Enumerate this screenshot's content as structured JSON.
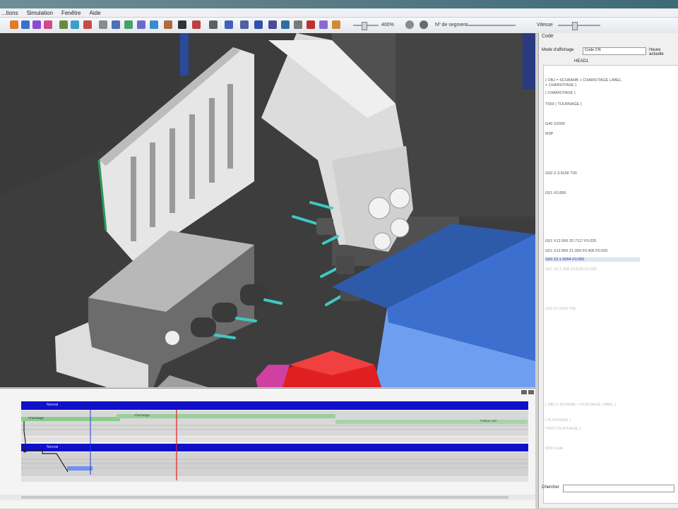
{
  "menu": {
    "items": [
      "...tions",
      "Simulation",
      "Fenêtre",
      "Aide"
    ]
  },
  "toolbar": {
    "zoom": "400%",
    "segment_label": "Nº de segment",
    "speed_label": "Vitesse"
  },
  "panel": {
    "title": "Code",
    "mode_label": "Mode d'affichage",
    "mode_value": "Code CN",
    "position_label": "Heure actuelle",
    "header": "HEAD1",
    "code_lines": [
      {
        "text": "( OBJ = SCHAAHB + CHARIOTAGE LABEL",
        "cls": ""
      },
      {
        "text": "+ CHARIOTAGE )",
        "cls": ""
      },
      {
        "text": "( CHARIOTAGE )",
        "cls": ""
      },
      {
        "text": "T500 ( TOURNAGE )",
        "cls": ""
      },
      {
        "text": "G40 S2000",
        "cls": ""
      },
      {
        "text": "M3P",
        "cls": ""
      },
      {
        "text": "G00 Z-3.8106 T00",
        "cls": ""
      },
      {
        "text": "G01 X0.856",
        "cls": ""
      },
      {
        "text": "G01 X12.066 Z0.7117 F0.025",
        "cls": ""
      },
      {
        "text": "G01 X12.896 Z1.059 F0.405 F0.025",
        "cls": ""
      },
      {
        "text": "G00 Z3.1.6054 F0.050",
        "cls": "hl"
      },
      {
        "text": "G01 X0.1 Z08 Z24126 F0.025",
        "cls": "faint"
      },
      {
        "text": "G00 Z1.0106 T00",
        "cls": "faint"
      },
      {
        "text": "( OBJ = SCHAAB + PLATOAGE LABEL )",
        "cls": "faint"
      },
      {
        "text": "( PLATOAGE )",
        "cls": "faint"
      },
      {
        "text": "T600 ( PLATOAGE )",
        "cls": "faint"
      },
      {
        "text": "M30 Code",
        "cls": "faint"
      }
    ],
    "search_label": "Chercher"
  },
  "timeline": {
    "row1_label": "",
    "row2_label": "",
    "channel1": "Normal",
    "channel2": "Normal",
    "segments": [
      "Chariotage",
      "Chariotage",
      "Finition 1x0"
    ]
  }
}
